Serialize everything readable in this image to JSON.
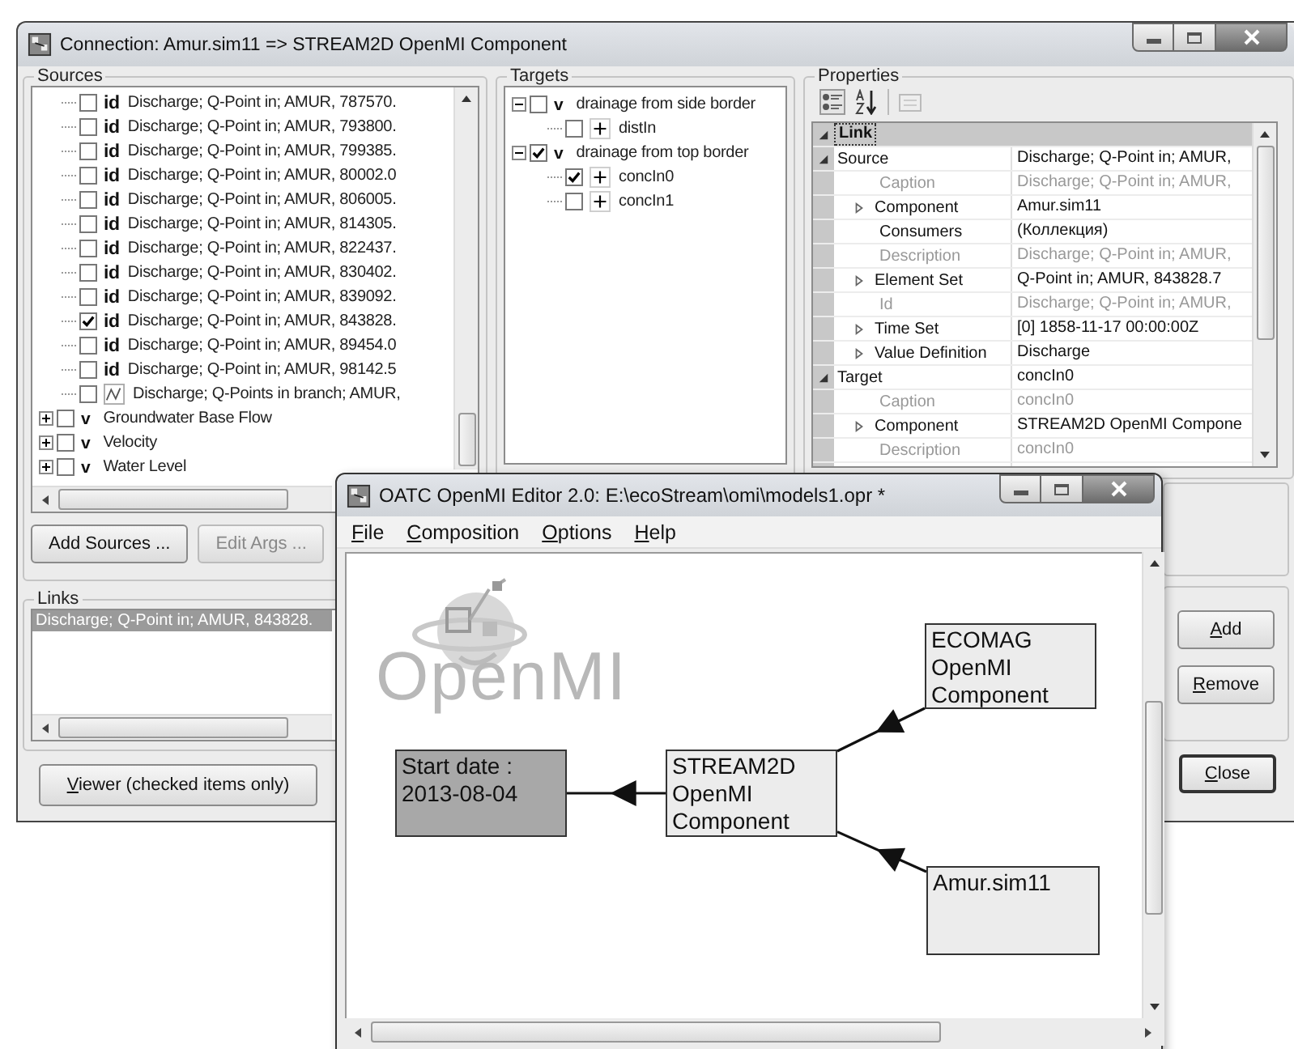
{
  "connection_window": {
    "title": "Connection: Amur.sim11 => STREAM2D OpenMI Component",
    "sources": {
      "title": "Sources",
      "tree": [
        {
          "children": [
            {
              "kind": "id",
              "badge": "id",
              "label": "Discharge; Q-Point in; AMUR, 787570.",
              "checked": false
            },
            {
              "kind": "id",
              "badge": "id",
              "label": "Discharge; Q-Point in; AMUR, 793800.",
              "checked": false
            },
            {
              "kind": "id",
              "badge": "id",
              "label": "Discharge; Q-Point in; AMUR, 799385.",
              "checked": false
            },
            {
              "kind": "id",
              "badge": "id",
              "label": "Discharge; Q-Point in; AMUR, 80002.0",
              "checked": false
            },
            {
              "kind": "id",
              "badge": "id",
              "label": "Discharge; Q-Point in; AMUR, 806005.",
              "checked": false
            },
            {
              "kind": "id",
              "badge": "id",
              "label": "Discharge; Q-Point in; AMUR, 814305.",
              "checked": false
            },
            {
              "kind": "id",
              "badge": "id",
              "label": "Discharge; Q-Point in; AMUR, 822437.",
              "checked": false
            },
            {
              "kind": "id",
              "badge": "id",
              "label": "Discharge; Q-Point in; AMUR, 830402.",
              "checked": false
            },
            {
              "kind": "id",
              "badge": "id",
              "label": "Discharge; Q-Point in; AMUR, 839092.",
              "checked": false
            },
            {
              "kind": "id",
              "badge": "id",
              "label": "Discharge; Q-Point in; AMUR, 843828.",
              "checked": true
            },
            {
              "kind": "id",
              "badge": "id",
              "label": "Discharge; Q-Point in; AMUR, 89454.0",
              "checked": false
            },
            {
              "kind": "id",
              "badge": "id",
              "label": "Discharge; Q-Point in; AMUR, 98142.5",
              "checked": false
            },
            {
              "kind": "branch",
              "label": "Discharge; Q-Points in branch; AMUR,",
              "checked": false
            }
          ]
        },
        {
          "kind": "v",
          "badge": "v",
          "label": "Groundwater Base Flow",
          "checked": false,
          "expanded": false
        },
        {
          "kind": "v",
          "badge": "v",
          "label": "Velocity",
          "checked": false,
          "expanded": false
        },
        {
          "kind": "v",
          "badge": "v",
          "label": "Water Level",
          "checked": false,
          "expanded": false
        }
      ],
      "buttons": [
        {
          "label": "Add Sources ...",
          "disabled": false
        },
        {
          "label": "Edit Args ...",
          "disabled": true
        }
      ]
    },
    "targets": {
      "title": "Targets",
      "tree": [
        {
          "kind": "v",
          "badge": "v",
          "label": "drainage from side border",
          "checked": false,
          "expanded": true,
          "children": [
            {
              "kind": "item",
              "label": "distIn",
              "checked": false
            }
          ]
        },
        {
          "kind": "v",
          "badge": "v",
          "label": "drainage from top border",
          "checked": true,
          "expanded": true,
          "children": [
            {
              "kind": "item",
              "label": "concIn0",
              "checked": true
            },
            {
              "kind": "item",
              "label": "concIn1",
              "checked": false
            }
          ]
        }
      ]
    },
    "properties": {
      "title": "Properties",
      "grid": [
        {
          "kind": "category",
          "label": "Link",
          "expanded": true,
          "children": [
            {
              "label": "Source",
              "value": "Discharge; Q-Point in; AMUR,",
              "expanded": true,
              "children": [
                {
                  "label": "Caption",
                  "value": "Discharge; Q-Point in; AMUR,",
                  "readonly": true
                },
                {
                  "label": "Component",
                  "value": "Amur.sim11",
                  "expanded": false
                },
                {
                  "label": "Consumers",
                  "value": "(Коллекция)"
                },
                {
                  "label": "Description",
                  "value": "Discharge; Q-Point in; AMUR,",
                  "readonly": true
                },
                {
                  "label": "Element Set",
                  "value": "Q-Point in; AMUR, 843828.7",
                  "expanded": false
                },
                {
                  "label": "Id",
                  "value": "Discharge; Q-Point in; AMUR,",
                  "readonly": true
                },
                {
                  "label": "Time Set",
                  "value": "[0] 1858-11-17 00:00:00Z",
                  "expanded": false
                },
                {
                  "label": "Value Definition",
                  "value": "Discharge",
                  "expanded": false
                }
              ]
            },
            {
              "label": "Target",
              "value": "concIn0",
              "expanded": true,
              "children": [
                {
                  "label": "Caption",
                  "value": "concIn0",
                  "readonly": true
                },
                {
                  "label": "Component",
                  "value": "STREAM2D OpenMI Compone",
                  "expanded": false
                },
                {
                  "label": "Description",
                  "value": "concIn0",
                  "readonly": true
                }
              ]
            }
          ]
        }
      ]
    },
    "links": {
      "title": "Links",
      "items": [
        {
          "label": "Discharge; Q-Point in; AMUR, 843828.",
          "selected": true
        }
      ]
    },
    "link_buttons": [
      "Add",
      "Remove"
    ],
    "viewer_button": "Viewer (checked items only)",
    "close_button": "Close"
  },
  "editor_window": {
    "title": "OATC OpenMI Editor 2.0: E:\\ecoStream\\omi\\models1.opr *",
    "menu": [
      "File",
      "Composition",
      "Options",
      "Help"
    ],
    "canvas": {
      "logo_text": "OpenMI",
      "nodes": [
        {
          "kind": "trigger",
          "lines": [
            "Start date :",
            "2013-08-04"
          ]
        },
        {
          "kind": "model",
          "lines": [
            "STREAM2D",
            "OpenMI",
            "Component"
          ]
        },
        {
          "kind": "model",
          "lines": [
            "ECOMAG",
            "OpenMI",
            "Component"
          ]
        },
        {
          "kind": "model",
          "lines": [
            "Amur.sim11"
          ]
        }
      ]
    }
  }
}
